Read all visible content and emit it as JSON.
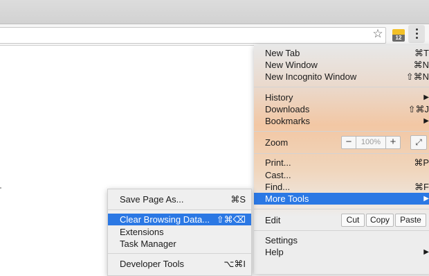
{
  "toolbar": {
    "bookmark_icon": "star-icon",
    "extension_badge": "12",
    "menu_icon": "kebab-icon"
  },
  "main_menu": {
    "new_tab": {
      "label": "New Tab",
      "shortcut": "⌘T"
    },
    "new_window": {
      "label": "New Window",
      "shortcut": "⌘N"
    },
    "new_incognito": {
      "label": "New Incognito Window",
      "shortcut": "⇧⌘N"
    },
    "history": {
      "label": "History",
      "arrow": "▶"
    },
    "downloads": {
      "label": "Downloads",
      "shortcut": "⇧⌘J"
    },
    "bookmarks": {
      "label": "Bookmarks",
      "arrow": "▶"
    },
    "zoom": {
      "label": "Zoom",
      "minus": "−",
      "value": "100%",
      "plus": "+",
      "fullscreen": "⤢"
    },
    "print": {
      "label": "Print...",
      "shortcut": "⌘P"
    },
    "cast": {
      "label": "Cast..."
    },
    "find": {
      "label": "Find...",
      "shortcut": "⌘F"
    },
    "more_tools": {
      "label": "More Tools",
      "arrow": "▶"
    },
    "edit": {
      "label": "Edit",
      "cut": "Cut",
      "copy": "Copy",
      "paste": "Paste"
    },
    "settings": {
      "label": "Settings"
    },
    "help": {
      "label": "Help",
      "arrow": "▶"
    }
  },
  "sub_menu": {
    "save_page": {
      "label": "Save Page As...",
      "shortcut": "⌘S"
    },
    "clear_browsing": {
      "label": "Clear Browsing Data...",
      "shortcut": "⇧⌘⌫"
    },
    "extensions": {
      "label": "Extensions"
    },
    "task_manager": {
      "label": "Task Manager"
    },
    "developer_tools": {
      "label": "Developer Tools",
      "shortcut": "⌥⌘I"
    }
  },
  "colors": {
    "highlight": "#2b78e4"
  }
}
